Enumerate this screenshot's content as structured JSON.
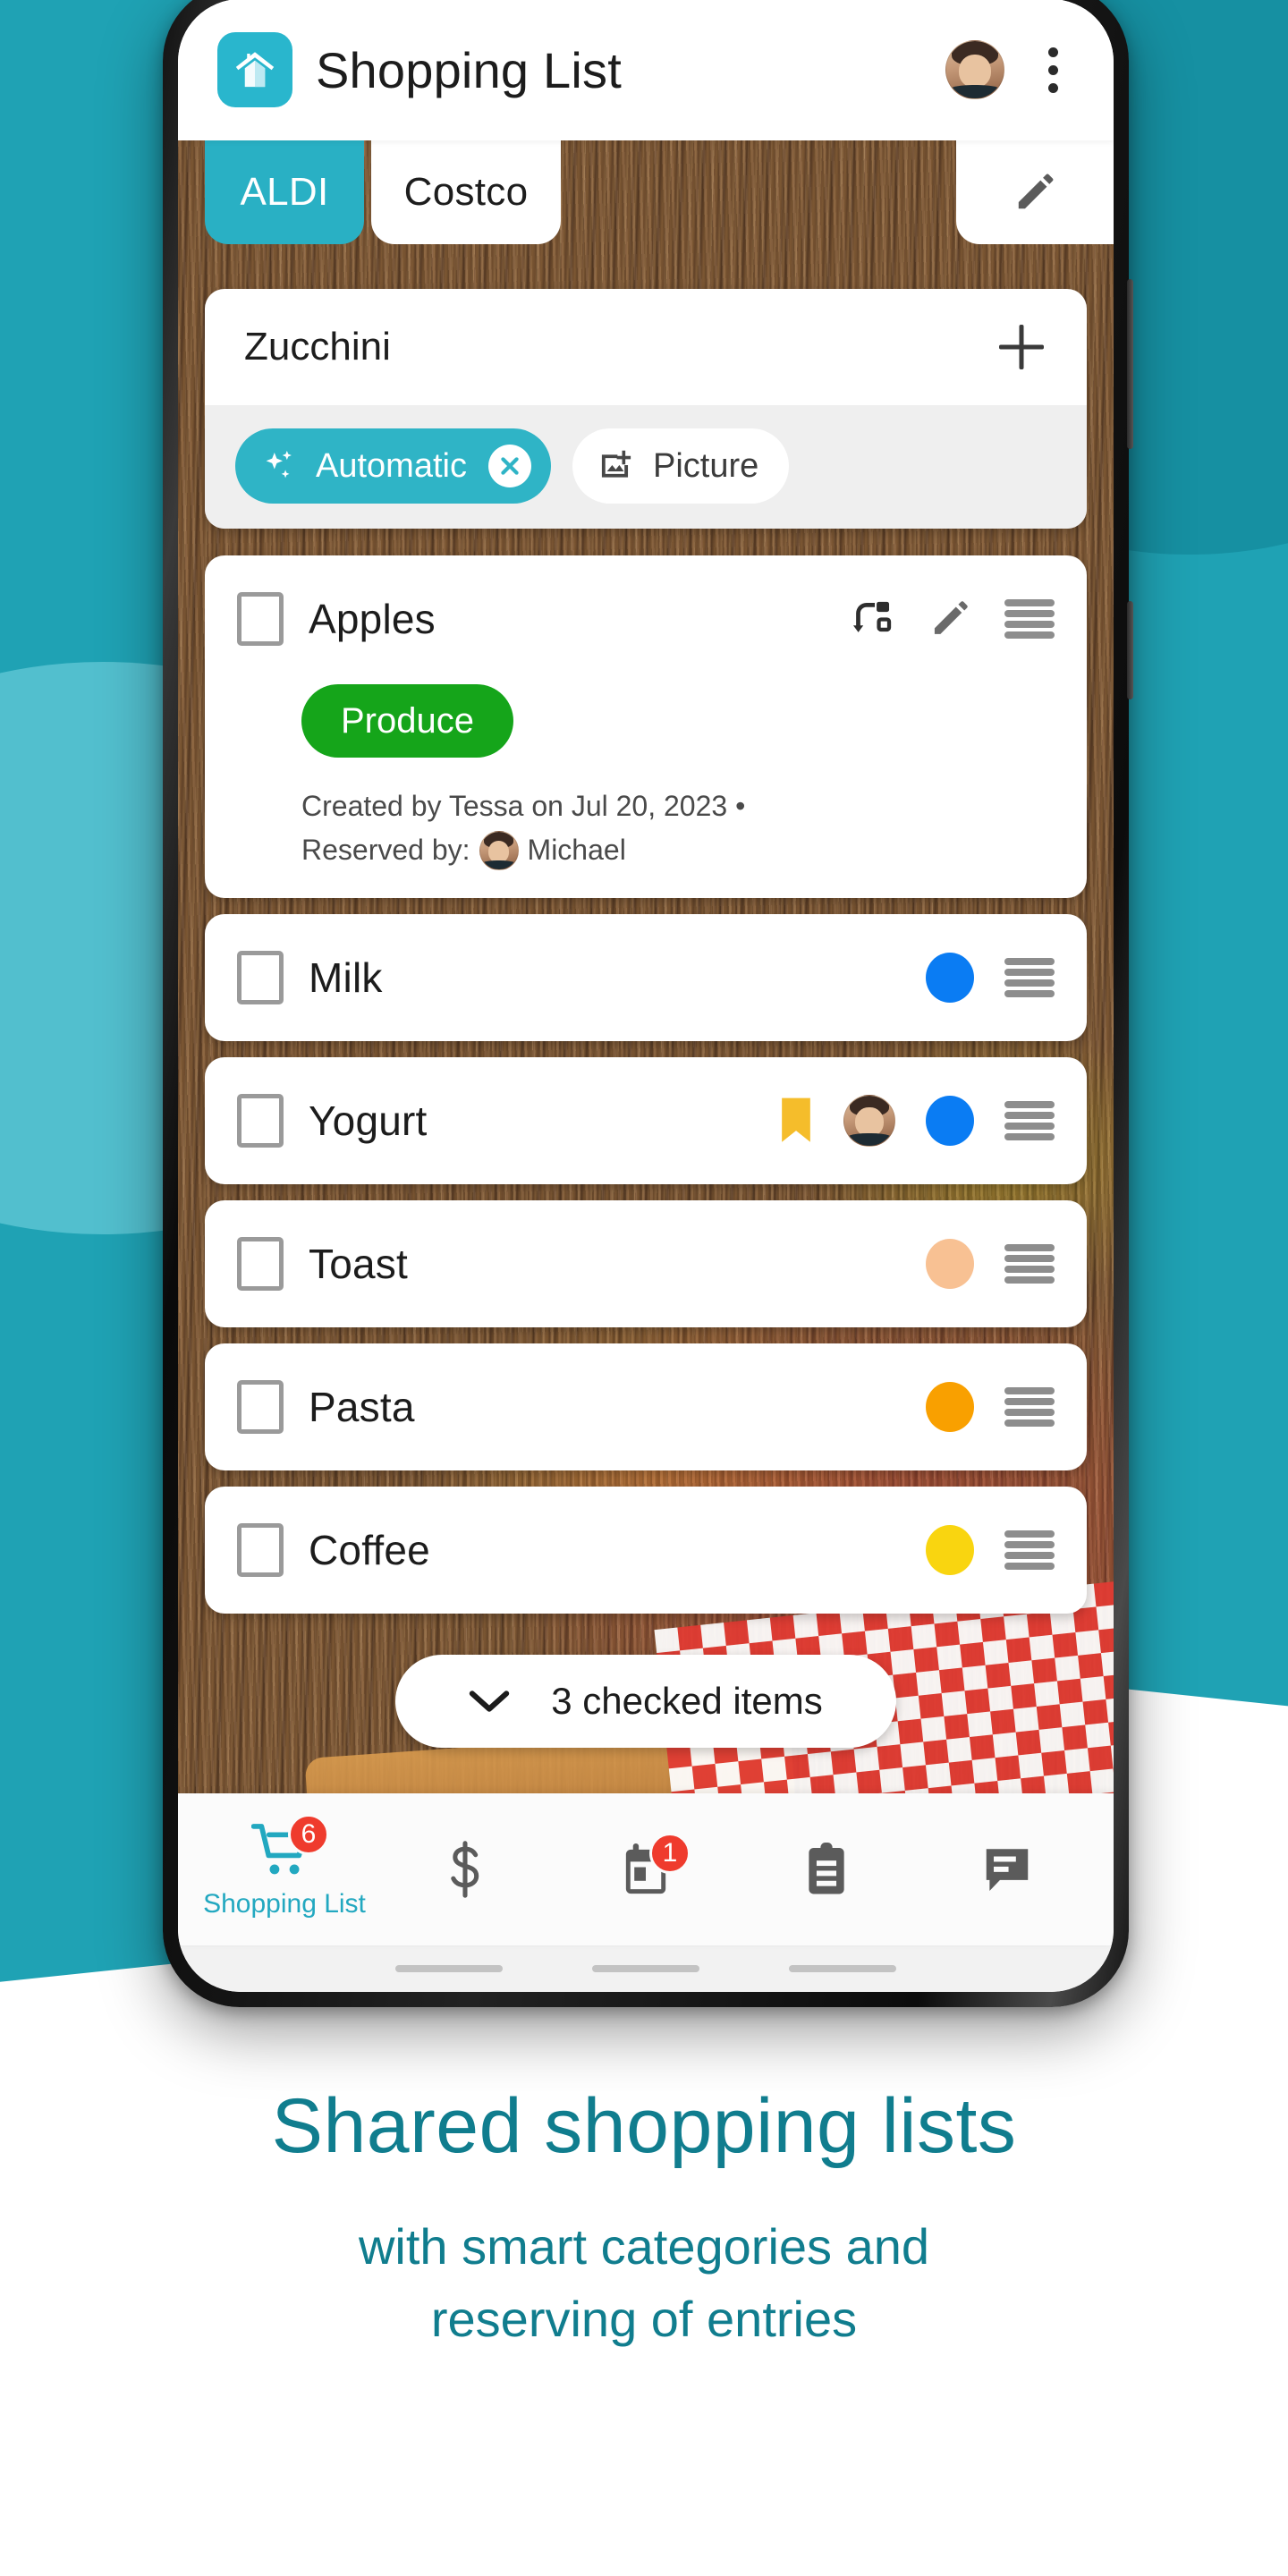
{
  "appbar": {
    "logo_icon": "house-icon",
    "title": "Shopping List",
    "avatar_name": "user-avatar",
    "overflow_icon": "more-vertical-icon"
  },
  "tabs": {
    "items": [
      {
        "label": "ALDI",
        "active": true
      },
      {
        "label": "Costco",
        "active": false
      }
    ],
    "edit_icon": "pencil-icon"
  },
  "add_item": {
    "value": "Zucchini",
    "placeholder": "Add item",
    "add_icon": "plus-icon",
    "chips": [
      {
        "label": "Automatic",
        "icon": "sparkles-icon",
        "selected": true,
        "remove_icon": "close-circle-icon"
      },
      {
        "label": "Picture",
        "icon": "add-photo-icon",
        "selected": false
      }
    ]
  },
  "list": {
    "items": [
      {
        "name": "Apples",
        "expanded": true,
        "category": "Produce",
        "category_color": "#15a51a",
        "repeat_icon": "repeat-icon",
        "edit_icon": "pencil-icon",
        "drag_icon": "drag-handle-icon",
        "meta_line1": "Created by Tessa on Jul 20, 2023 •",
        "meta_line2_label": "Reserved by:",
        "meta_line2_user": "Michael"
      },
      {
        "name": "Milk",
        "expanded": false,
        "dot_color": "#0a7cf3",
        "drag_icon": "drag-handle-icon"
      },
      {
        "name": "Yogurt",
        "expanded": false,
        "bookmark_icon": "bookmark-icon",
        "bookmark_color": "#f5bd2b",
        "reserved_avatar": "user-avatar",
        "dot_color": "#0a7cf3",
        "drag_icon": "drag-handle-icon"
      },
      {
        "name": "Toast",
        "expanded": false,
        "dot_color": "#f8c193",
        "drag_icon": "drag-handle-icon"
      },
      {
        "name": "Pasta",
        "expanded": false,
        "dot_color": "#f9a000",
        "drag_icon": "drag-handle-icon"
      },
      {
        "name": "Coffee",
        "expanded": false,
        "dot_color": "#f9d510",
        "drag_icon": "drag-handle-icon"
      }
    ]
  },
  "checked": {
    "label": "3 checked items",
    "chevron_icon": "chevron-down-icon"
  },
  "bottom_nav": {
    "items": [
      {
        "label": "Shopping List",
        "icon": "shopping-cart-icon",
        "badge": "6",
        "active": true
      },
      {
        "label": "",
        "icon": "dollar-icon",
        "badge": "",
        "active": false
      },
      {
        "label": "",
        "icon": "calendar-icon",
        "badge": "1",
        "active": false
      },
      {
        "label": "",
        "icon": "clipboard-icon",
        "badge": "",
        "active": false
      },
      {
        "label": "",
        "icon": "chat-icon",
        "badge": "",
        "active": false
      }
    ]
  },
  "caption": {
    "title": "Shared shopping lists",
    "subtitle_line1": "with smart categories and",
    "subtitle_line2": "reserving of entries"
  },
  "colors": {
    "brand_teal": "#1fa2b4",
    "tab_active": "#29b0c4",
    "chip_primary": "#2fb4c6",
    "caption_text": "#107d8e",
    "badge_red": "#ef3b2d",
    "category_green": "#15a51a"
  }
}
